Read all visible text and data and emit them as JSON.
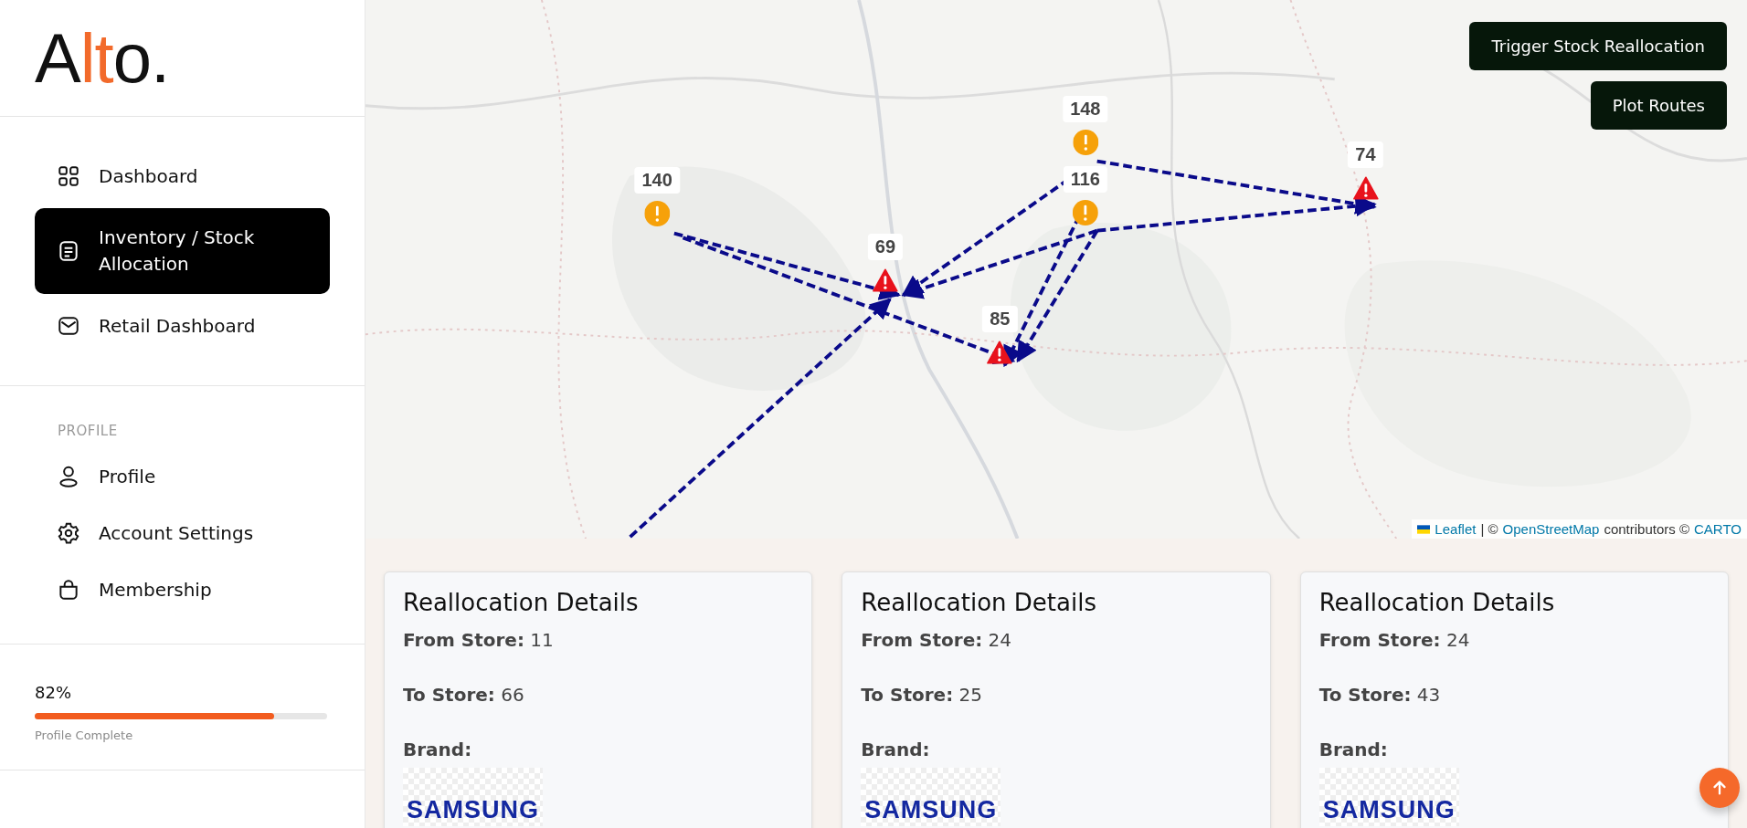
{
  "logo": {
    "before": "A",
    "accent": "lt",
    "after": "o."
  },
  "nav": [
    {
      "label": "Dashboard",
      "selected": false
    },
    {
      "label": "Inventory / Stock Allocation",
      "selected": true
    },
    {
      "label": "Retail Dashboard",
      "selected": false
    }
  ],
  "profile_section": {
    "heading": "PROFILE",
    "items": [
      {
        "label": "Profile"
      },
      {
        "label": "Account Settings"
      },
      {
        "label": "Membership"
      }
    ]
  },
  "profile_progress": {
    "reading": "82%",
    "level": 0.82,
    "caption": "Profile Complete"
  },
  "map": {
    "buttons": [
      "Trigger Stock Reallocation",
      "Plot Routes"
    ],
    "markers": [
      {
        "label": "140",
        "kind": "warning"
      },
      {
        "label": "148",
        "kind": "warning"
      },
      {
        "label": "116",
        "kind": "warning"
      },
      {
        "label": "69",
        "kind": "alert"
      },
      {
        "label": "85",
        "kind": "alert"
      },
      {
        "label": "74",
        "kind": "alert"
      }
    ],
    "attribution": {
      "leaflet": "Leaflet",
      "sep": "| ©",
      "osm": "OpenStreetMap",
      "contributors": "contributors ©",
      "carto": "CARTO"
    }
  },
  "cards": [
    {
      "title": "Reallocation Details",
      "from": "**From Store:** 11",
      "to": "**To Store:** 66",
      "brand_label": "Brand:",
      "brand": "SAMSUNG"
    },
    {
      "title": "Reallocation Details",
      "from": "**From Store:** 24",
      "to": "**To Store:** 25",
      "brand_label": "Brand:",
      "brand": "SAMSUNG"
    },
    {
      "title": "Reallocation Details",
      "from": "**From Store:** 24",
      "to": "**To Store:** 43",
      "brand_label": "Brand:",
      "brand": "SAMSUNG"
    }
  ]
}
